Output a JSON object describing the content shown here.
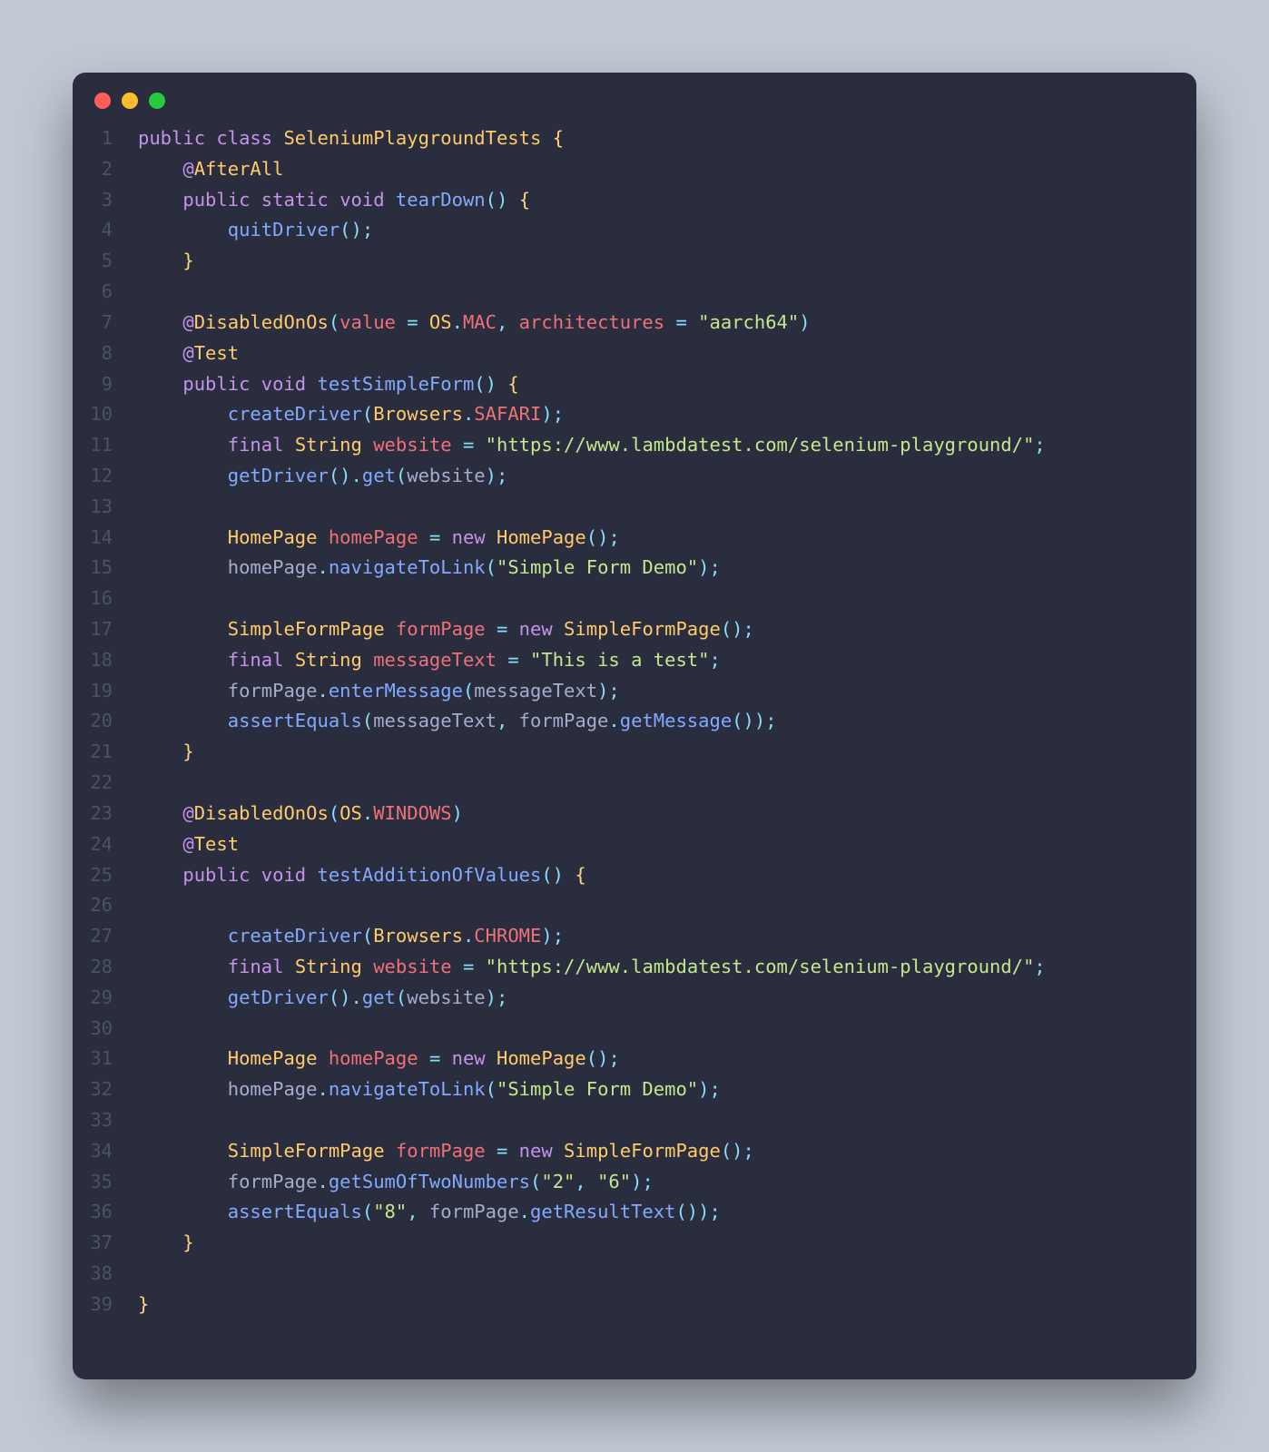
{
  "theme": {
    "background": "#292d3e",
    "page_background": "#c2c9d4",
    "gutter_color": "#4b5263",
    "text_color": "#a6accd",
    "colors": {
      "keyword": "#c792ea",
      "type": "#ffcb6b",
      "function": "#82aaff",
      "variable": "#f07178",
      "string": "#c3e88d",
      "operator": "#89ddff",
      "brace": "#ffd580"
    }
  },
  "window": {
    "traffic_lights": [
      "close",
      "minimize",
      "zoom"
    ]
  },
  "code": {
    "language": "java",
    "lines": [
      {
        "n": "1",
        "indent": 0,
        "tokens": [
          [
            "kw",
            "public"
          ],
          [
            "plain",
            " "
          ],
          [
            "kw",
            "class"
          ],
          [
            "plain",
            " "
          ],
          [
            "type",
            "SeleniumPlaygroundTests"
          ],
          [
            "plain",
            " "
          ],
          [
            "punc",
            "{"
          ]
        ]
      },
      {
        "n": "2",
        "indent": 1,
        "tokens": [
          [
            "ann",
            "@"
          ],
          [
            "anname",
            "AfterAll"
          ]
        ]
      },
      {
        "n": "3",
        "indent": 1,
        "tokens": [
          [
            "kw",
            "public"
          ],
          [
            "plain",
            " "
          ],
          [
            "kw",
            "static"
          ],
          [
            "plain",
            " "
          ],
          [
            "kw",
            "void"
          ],
          [
            "plain",
            " "
          ],
          [
            "fn",
            "tearDown"
          ],
          [
            "paren",
            "()"
          ],
          [
            "plain",
            " "
          ],
          [
            "punc",
            "{"
          ]
        ]
      },
      {
        "n": "4",
        "indent": 2,
        "tokens": [
          [
            "fn",
            "quitDriver"
          ],
          [
            "paren",
            "()"
          ],
          [
            "op",
            ";"
          ]
        ]
      },
      {
        "n": "5",
        "indent": 1,
        "tokens": [
          [
            "punc",
            "}"
          ]
        ]
      },
      {
        "n": "6",
        "indent": 0,
        "tokens": []
      },
      {
        "n": "7",
        "indent": 1,
        "tokens": [
          [
            "ann",
            "@"
          ],
          [
            "anname",
            "DisabledOnOs"
          ],
          [
            "paren",
            "("
          ],
          [
            "var",
            "value"
          ],
          [
            "plain",
            " "
          ],
          [
            "op",
            "="
          ],
          [
            "plain",
            " "
          ],
          [
            "type",
            "OS"
          ],
          [
            "op",
            "."
          ],
          [
            "var",
            "MAC"
          ],
          [
            "op",
            ","
          ],
          [
            "plain",
            " "
          ],
          [
            "var",
            "architectures"
          ],
          [
            "plain",
            " "
          ],
          [
            "op",
            "="
          ],
          [
            "plain",
            " "
          ],
          [
            "str",
            "\"aarch64\""
          ],
          [
            "paren",
            ")"
          ]
        ]
      },
      {
        "n": "8",
        "indent": 1,
        "tokens": [
          [
            "ann",
            "@"
          ],
          [
            "anname",
            "Test"
          ]
        ]
      },
      {
        "n": "9",
        "indent": 1,
        "tokens": [
          [
            "kw",
            "public"
          ],
          [
            "plain",
            " "
          ],
          [
            "kw",
            "void"
          ],
          [
            "plain",
            " "
          ],
          [
            "fn",
            "testSimpleForm"
          ],
          [
            "paren",
            "()"
          ],
          [
            "plain",
            " "
          ],
          [
            "punc",
            "{"
          ]
        ]
      },
      {
        "n": "10",
        "indent": 2,
        "tokens": [
          [
            "fn",
            "createDriver"
          ],
          [
            "paren",
            "("
          ],
          [
            "type",
            "Browsers"
          ],
          [
            "op",
            "."
          ],
          [
            "var",
            "SAFARI"
          ],
          [
            "paren",
            ")"
          ],
          [
            "op",
            ";"
          ]
        ]
      },
      {
        "n": "11",
        "indent": 2,
        "tokens": [
          [
            "kw",
            "final"
          ],
          [
            "plain",
            " "
          ],
          [
            "type",
            "String"
          ],
          [
            "plain",
            " "
          ],
          [
            "var",
            "website"
          ],
          [
            "plain",
            " "
          ],
          [
            "op",
            "="
          ],
          [
            "plain",
            " "
          ],
          [
            "str",
            "\"https://www.lambdatest.com/selenium-playground/\""
          ],
          [
            "op",
            ";"
          ]
        ]
      },
      {
        "n": "12",
        "indent": 2,
        "tokens": [
          [
            "fn",
            "getDriver"
          ],
          [
            "paren",
            "()"
          ],
          [
            "op",
            "."
          ],
          [
            "fn",
            "get"
          ],
          [
            "paren",
            "("
          ],
          [
            "plain",
            "website"
          ],
          [
            "paren",
            ")"
          ],
          [
            "op",
            ";"
          ]
        ]
      },
      {
        "n": "13",
        "indent": 0,
        "tokens": []
      },
      {
        "n": "14",
        "indent": 2,
        "tokens": [
          [
            "type",
            "HomePage"
          ],
          [
            "plain",
            " "
          ],
          [
            "var",
            "homePage"
          ],
          [
            "plain",
            " "
          ],
          [
            "op",
            "="
          ],
          [
            "plain",
            " "
          ],
          [
            "kw",
            "new"
          ],
          [
            "plain",
            " "
          ],
          [
            "type",
            "HomePage"
          ],
          [
            "paren",
            "()"
          ],
          [
            "op",
            ";"
          ]
        ]
      },
      {
        "n": "15",
        "indent": 2,
        "tokens": [
          [
            "plain",
            "homePage"
          ],
          [
            "op",
            "."
          ],
          [
            "fn",
            "navigateToLink"
          ],
          [
            "paren",
            "("
          ],
          [
            "str",
            "\"Simple Form Demo\""
          ],
          [
            "paren",
            ")"
          ],
          [
            "op",
            ";"
          ]
        ]
      },
      {
        "n": "16",
        "indent": 0,
        "tokens": []
      },
      {
        "n": "17",
        "indent": 2,
        "tokens": [
          [
            "type",
            "SimpleFormPage"
          ],
          [
            "plain",
            " "
          ],
          [
            "var",
            "formPage"
          ],
          [
            "plain",
            " "
          ],
          [
            "op",
            "="
          ],
          [
            "plain",
            " "
          ],
          [
            "kw",
            "new"
          ],
          [
            "plain",
            " "
          ],
          [
            "type",
            "SimpleFormPage"
          ],
          [
            "paren",
            "()"
          ],
          [
            "op",
            ";"
          ]
        ]
      },
      {
        "n": "18",
        "indent": 2,
        "tokens": [
          [
            "kw",
            "final"
          ],
          [
            "plain",
            " "
          ],
          [
            "type",
            "String"
          ],
          [
            "plain",
            " "
          ],
          [
            "var",
            "messageText"
          ],
          [
            "plain",
            " "
          ],
          [
            "op",
            "="
          ],
          [
            "plain",
            " "
          ],
          [
            "str",
            "\"This is a test\""
          ],
          [
            "op",
            ";"
          ]
        ]
      },
      {
        "n": "19",
        "indent": 2,
        "tokens": [
          [
            "plain",
            "formPage"
          ],
          [
            "op",
            "."
          ],
          [
            "fn",
            "enterMessage"
          ],
          [
            "paren",
            "("
          ],
          [
            "plain",
            "messageText"
          ],
          [
            "paren",
            ")"
          ],
          [
            "op",
            ";"
          ]
        ]
      },
      {
        "n": "20",
        "indent": 2,
        "tokens": [
          [
            "fn",
            "assertEquals"
          ],
          [
            "paren",
            "("
          ],
          [
            "plain",
            "messageText"
          ],
          [
            "op",
            ","
          ],
          [
            "plain",
            " formPage"
          ],
          [
            "op",
            "."
          ],
          [
            "fn",
            "getMessage"
          ],
          [
            "paren",
            "())"
          ],
          [
            "op",
            ";"
          ]
        ]
      },
      {
        "n": "21",
        "indent": 1,
        "tokens": [
          [
            "punc",
            "}"
          ]
        ]
      },
      {
        "n": "22",
        "indent": 0,
        "tokens": []
      },
      {
        "n": "23",
        "indent": 1,
        "tokens": [
          [
            "ann",
            "@"
          ],
          [
            "anname",
            "DisabledOnOs"
          ],
          [
            "paren",
            "("
          ],
          [
            "type",
            "OS"
          ],
          [
            "op",
            "."
          ],
          [
            "var",
            "WINDOWS"
          ],
          [
            "paren",
            ")"
          ]
        ]
      },
      {
        "n": "24",
        "indent": 1,
        "tokens": [
          [
            "ann",
            "@"
          ],
          [
            "anname",
            "Test"
          ]
        ]
      },
      {
        "n": "25",
        "indent": 1,
        "tokens": [
          [
            "kw",
            "public"
          ],
          [
            "plain",
            " "
          ],
          [
            "kw",
            "void"
          ],
          [
            "plain",
            " "
          ],
          [
            "fn",
            "testAdditionOfValues"
          ],
          [
            "paren",
            "()"
          ],
          [
            "plain",
            " "
          ],
          [
            "punc",
            "{"
          ]
        ]
      },
      {
        "n": "26",
        "indent": 0,
        "tokens": []
      },
      {
        "n": "27",
        "indent": 2,
        "tokens": [
          [
            "fn",
            "createDriver"
          ],
          [
            "paren",
            "("
          ],
          [
            "type",
            "Browsers"
          ],
          [
            "op",
            "."
          ],
          [
            "var",
            "CHROME"
          ],
          [
            "paren",
            ")"
          ],
          [
            "op",
            ";"
          ]
        ]
      },
      {
        "n": "28",
        "indent": 2,
        "tokens": [
          [
            "kw",
            "final"
          ],
          [
            "plain",
            " "
          ],
          [
            "type",
            "String"
          ],
          [
            "plain",
            " "
          ],
          [
            "var",
            "website"
          ],
          [
            "plain",
            " "
          ],
          [
            "op",
            "="
          ],
          [
            "plain",
            " "
          ],
          [
            "str",
            "\"https://www.lambdatest.com/selenium-playground/\""
          ],
          [
            "op",
            ";"
          ]
        ]
      },
      {
        "n": "29",
        "indent": 2,
        "tokens": [
          [
            "fn",
            "getDriver"
          ],
          [
            "paren",
            "()"
          ],
          [
            "op",
            "."
          ],
          [
            "fn",
            "get"
          ],
          [
            "paren",
            "("
          ],
          [
            "plain",
            "website"
          ],
          [
            "paren",
            ")"
          ],
          [
            "op",
            ";"
          ]
        ]
      },
      {
        "n": "30",
        "indent": 0,
        "tokens": []
      },
      {
        "n": "31",
        "indent": 2,
        "tokens": [
          [
            "type",
            "HomePage"
          ],
          [
            "plain",
            " "
          ],
          [
            "var",
            "homePage"
          ],
          [
            "plain",
            " "
          ],
          [
            "op",
            "="
          ],
          [
            "plain",
            " "
          ],
          [
            "kw",
            "new"
          ],
          [
            "plain",
            " "
          ],
          [
            "type",
            "HomePage"
          ],
          [
            "paren",
            "()"
          ],
          [
            "op",
            ";"
          ]
        ]
      },
      {
        "n": "32",
        "indent": 2,
        "tokens": [
          [
            "plain",
            "homePage"
          ],
          [
            "op",
            "."
          ],
          [
            "fn",
            "navigateToLink"
          ],
          [
            "paren",
            "("
          ],
          [
            "str",
            "\"Simple Form Demo\""
          ],
          [
            "paren",
            ")"
          ],
          [
            "op",
            ";"
          ]
        ]
      },
      {
        "n": "33",
        "indent": 0,
        "tokens": []
      },
      {
        "n": "34",
        "indent": 2,
        "tokens": [
          [
            "type",
            "SimpleFormPage"
          ],
          [
            "plain",
            " "
          ],
          [
            "var",
            "formPage"
          ],
          [
            "plain",
            " "
          ],
          [
            "op",
            "="
          ],
          [
            "plain",
            " "
          ],
          [
            "kw",
            "new"
          ],
          [
            "plain",
            " "
          ],
          [
            "type",
            "SimpleFormPage"
          ],
          [
            "paren",
            "()"
          ],
          [
            "op",
            ";"
          ]
        ]
      },
      {
        "n": "35",
        "indent": 2,
        "tokens": [
          [
            "plain",
            "formPage"
          ],
          [
            "op",
            "."
          ],
          [
            "fn",
            "getSumOfTwoNumbers"
          ],
          [
            "paren",
            "("
          ],
          [
            "str",
            "\"2\""
          ],
          [
            "op",
            ","
          ],
          [
            "plain",
            " "
          ],
          [
            "str",
            "\"6\""
          ],
          [
            "paren",
            ")"
          ],
          [
            "op",
            ";"
          ]
        ]
      },
      {
        "n": "36",
        "indent": 2,
        "tokens": [
          [
            "fn",
            "assertEquals"
          ],
          [
            "paren",
            "("
          ],
          [
            "str",
            "\"8\""
          ],
          [
            "op",
            ","
          ],
          [
            "plain",
            " formPage"
          ],
          [
            "op",
            "."
          ],
          [
            "fn",
            "getResultText"
          ],
          [
            "paren",
            "())"
          ],
          [
            "op",
            ";"
          ]
        ]
      },
      {
        "n": "37",
        "indent": 1,
        "tokens": [
          [
            "punc",
            "}"
          ]
        ]
      },
      {
        "n": "38",
        "indent": 0,
        "tokens": []
      },
      {
        "n": "39",
        "indent": 0,
        "tokens": [
          [
            "punc",
            "}"
          ]
        ]
      }
    ]
  }
}
